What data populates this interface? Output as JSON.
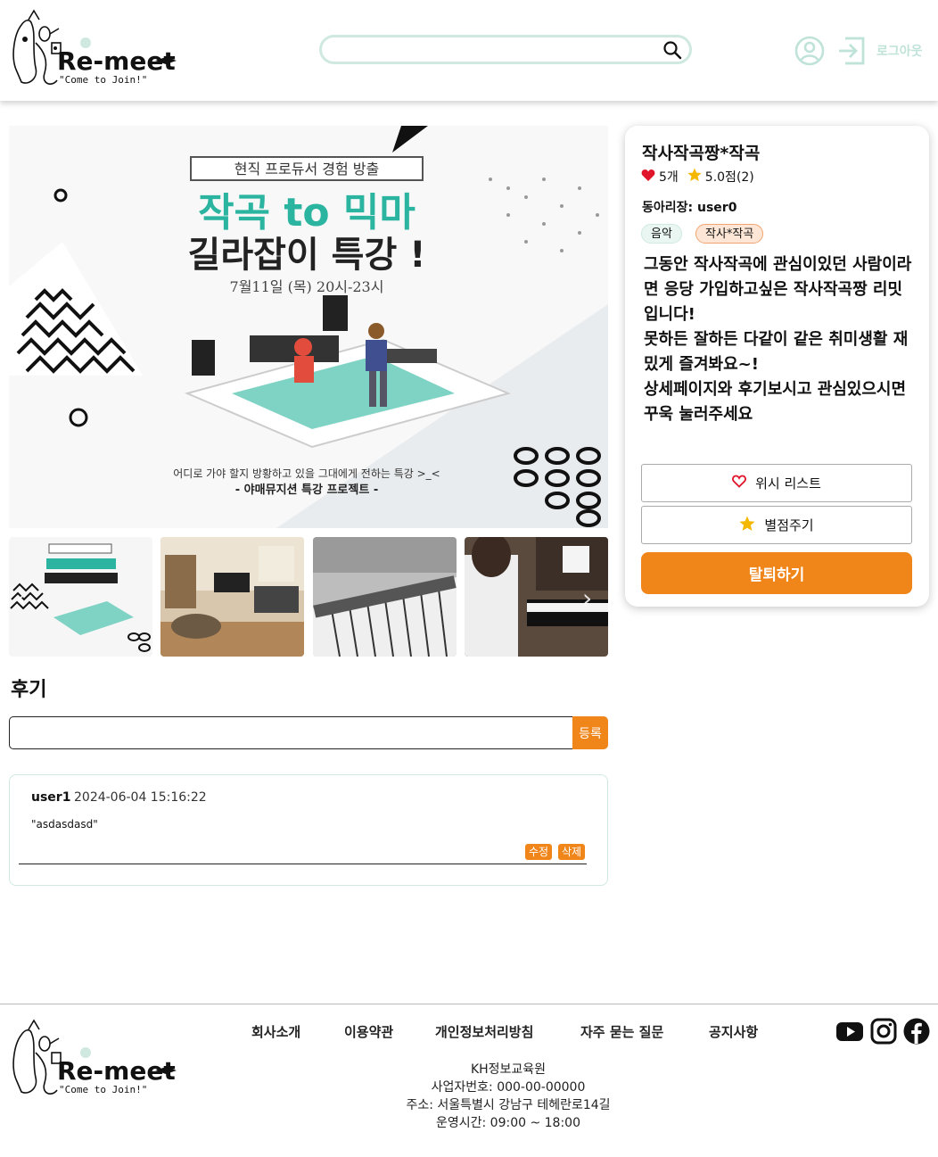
{
  "header": {
    "logo_text": "Re-meet",
    "logo_subtext": "\"Come to Join!\"",
    "search_placeholder": "",
    "logout_label": "로그아웃"
  },
  "poster": {
    "badge": "현직 프로듀서 경험 방출",
    "title_line1": "작곡 to 믹마",
    "title_line2": "길라잡이 특강 !",
    "date": "7월11일 (목) 20시-23시",
    "caption1": "어디로 가야 할지 방황하고 있을 그대에게 전하는 특강 >_<",
    "caption2": "- 야매뮤지션 특강 프로젝트 -"
  },
  "club": {
    "name": "작사작곡짱*작곡",
    "likes": "5개",
    "rating": "5.0점(2)",
    "leader_label": "동아리장:",
    "leader": "user0",
    "tags": [
      "음악",
      "작사*작곡"
    ],
    "description": "그동안 작사작곡에 관심이있던 사람이라면 응당 가입하고싶은 작사작곡짱 리밋입니다!\n못하든 잘하든 다같이 같은 취미생활 재밌게 즐겨봐요~!\n상세페이지와 후기보시고 관심있으시면 꾸욱 눌러주세요",
    "wish_label": "위시 리스트",
    "rate_label": "별점주기",
    "leave_label": "탈퇴하기"
  },
  "reviews": {
    "title": "후기",
    "input_placeholder": "",
    "submit_label": "등록",
    "items": [
      {
        "user": "user1",
        "date": "2024-06-04 15:16:22",
        "text": "\"asdasdasd\"",
        "edit": "수정",
        "delete": "삭제"
      }
    ]
  },
  "footer": {
    "nav": [
      "회사소개",
      "이용약관",
      "개인정보처리방침",
      "자주 묻는 질문",
      "공지사항"
    ],
    "company": "KH정보교육원",
    "business_no": "사업자번호: 000-00-00000",
    "address": "주소: 서울특별시 강남구 테헤란로14길",
    "hours": "운영시간: 09:00 ~ 18:00"
  },
  "colors": {
    "accent": "#f08519",
    "mint": "#cfe9e1",
    "heart": "#e0142a",
    "star": "#f5b800"
  },
  "icons": [
    "search-icon",
    "user-icon",
    "logout-icon",
    "heart-icon",
    "star-icon",
    "youtube-icon",
    "instagram-icon",
    "facebook-icon"
  ]
}
